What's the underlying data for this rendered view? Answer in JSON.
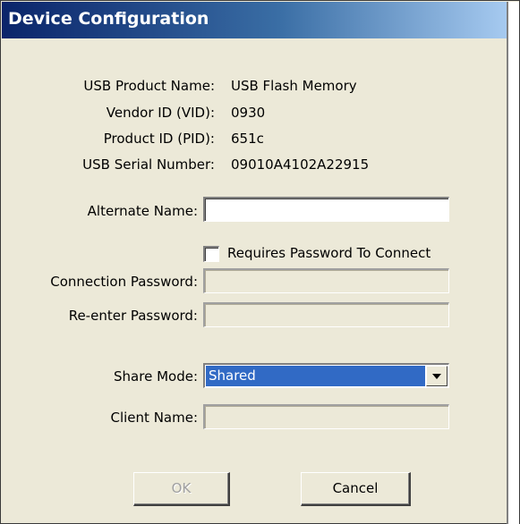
{
  "window": {
    "title": "Device Configuration"
  },
  "info": {
    "product_name_label": "USB Product Name:",
    "product_name_value": "USB Flash Memory",
    "vendor_id_label": "Vendor ID (VID):",
    "vendor_id_value": "0930",
    "product_id_label": "Product ID (PID):",
    "product_id_value": "651c",
    "serial_label": "USB Serial Number:",
    "serial_value": "09010A4102A22915"
  },
  "form": {
    "alternate_name_label": "Alternate Name:",
    "alternate_name_value": "",
    "requires_password_label": "Requires Password To Connect",
    "requires_password_checked": false,
    "connection_password_label": "Connection Password:",
    "connection_password_value": "",
    "reenter_password_label": "Re-enter Password:",
    "reenter_password_value": "",
    "share_mode_label": "Share Mode:",
    "share_mode_value": "Shared",
    "client_name_label": "Client Name:",
    "client_name_value": ""
  },
  "buttons": {
    "ok_label": "OK",
    "cancel_label": "Cancel"
  },
  "colors": {
    "dialog_bg": "#ece9d8",
    "selection": "#316ac5",
    "title_start": "#0a246a",
    "title_end": "#a6caf0"
  }
}
